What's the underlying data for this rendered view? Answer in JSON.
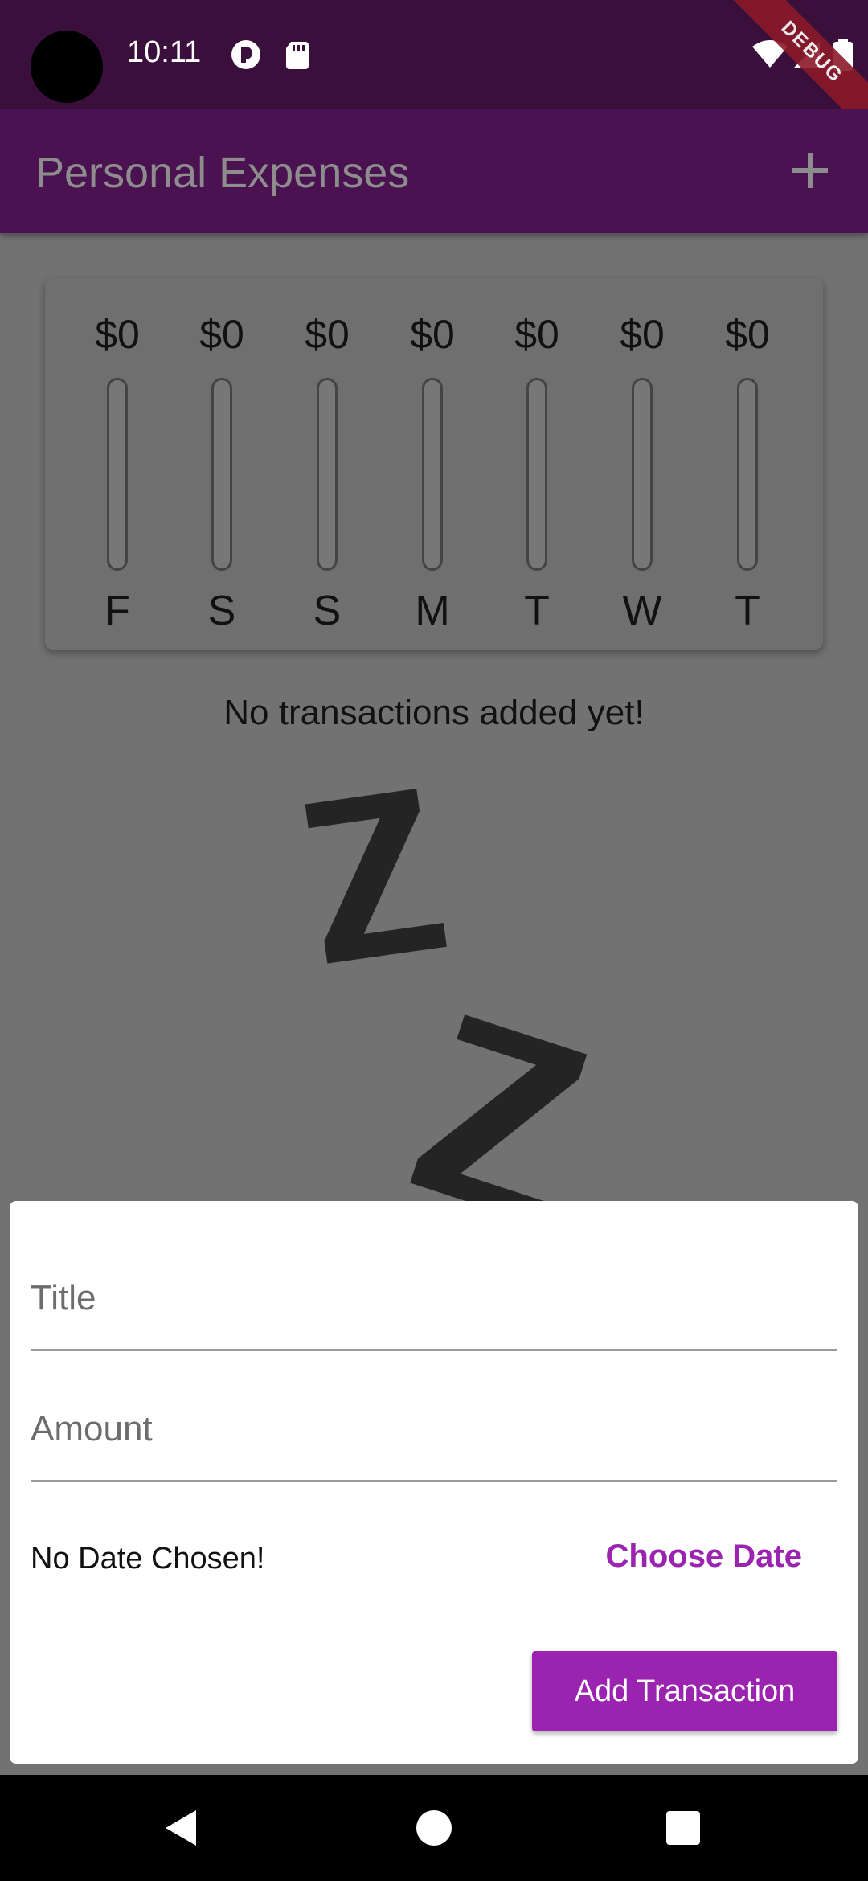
{
  "status_bar": {
    "time": "10:11",
    "icons": [
      "app-icon",
      "sd-card-icon",
      "wifi-icon",
      "signal-icon",
      "battery-icon"
    ],
    "debug_label": "DEBUG"
  },
  "app_bar": {
    "title": "Personal Expenses",
    "action_icon": "add-icon"
  },
  "chart": {
    "bars": [
      {
        "amount": "$0",
        "day": "F",
        "fill": 0
      },
      {
        "amount": "$0",
        "day": "S",
        "fill": 0
      },
      {
        "amount": "$0",
        "day": "S",
        "fill": 0
      },
      {
        "amount": "$0",
        "day": "M",
        "fill": 0
      },
      {
        "amount": "$0",
        "day": "T",
        "fill": 0
      },
      {
        "amount": "$0",
        "day": "W",
        "fill": 0
      },
      {
        "amount": "$0",
        "day": "T",
        "fill": 0
      }
    ]
  },
  "empty_state": {
    "message": "No transactions added yet!",
    "image": "zz-sleep-icon"
  },
  "form": {
    "title_placeholder": "Title",
    "amount_placeholder": "Amount",
    "date_text": "No Date Chosen!",
    "choose_date_label": "Choose Date",
    "submit_label": "Add Transaction"
  },
  "colors": {
    "primary": "#9a23b0",
    "app_bar": "#4b1252",
    "status_bar": "#3b0f3c"
  },
  "nav_bar": {
    "icons": [
      "back-icon",
      "home-icon",
      "recents-icon"
    ]
  }
}
